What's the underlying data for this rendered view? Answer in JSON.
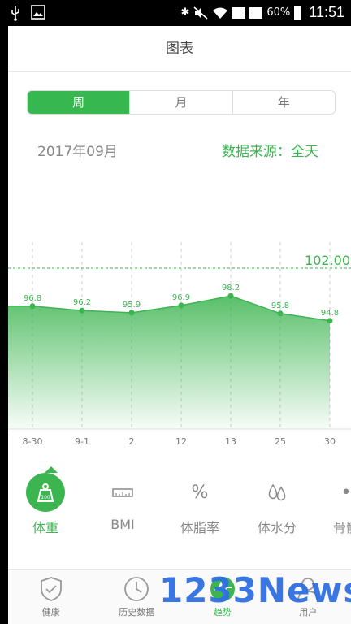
{
  "status_bar": {
    "battery": "60%",
    "time": "11:51"
  },
  "title": "图表",
  "tabs": [
    {
      "label": "周",
      "active": true
    },
    {
      "label": "月",
      "active": false
    },
    {
      "label": "年",
      "active": false
    }
  ],
  "month_label": "2017年09月",
  "data_source": "数据来源：全天",
  "chart_data": {
    "type": "area",
    "categories": [
      "8-30",
      "9-1",
      "2",
      "12",
      "13",
      "25",
      "30"
    ],
    "values": [
      96.8,
      96.2,
      95.9,
      96.9,
      98.2,
      95.8,
      94.8
    ],
    "value_labels": [
      "96.8",
      "96.2",
      "95.9",
      "96.9",
      "98.2",
      "95.8",
      "94.8"
    ],
    "target_value": 102.0,
    "target_label": "102.00",
    "color": "#3cb551"
  },
  "metrics": [
    {
      "label": "体重",
      "icon": "weight-icon",
      "active": true,
      "badge": "100"
    },
    {
      "label": "BMI",
      "icon": "ruler-icon",
      "active": false
    },
    {
      "label": "体脂率",
      "icon": "percent-icon",
      "active": false
    },
    {
      "label": "体水分",
      "icon": "water-drops-icon",
      "active": false
    },
    {
      "label": "骨骼",
      "icon": "bone-icon",
      "active": false
    }
  ],
  "bottom_nav": [
    {
      "label": "健康",
      "icon": "shield-check-icon",
      "active": false
    },
    {
      "label": "历史数据",
      "icon": "clock-icon",
      "active": false
    },
    {
      "label": "趋势",
      "icon": "trend-icon",
      "active": true
    },
    {
      "label": "用户",
      "icon": "user-icon",
      "active": false
    }
  ],
  "watermark": "1233News",
  "accent_color": "#3cb551"
}
